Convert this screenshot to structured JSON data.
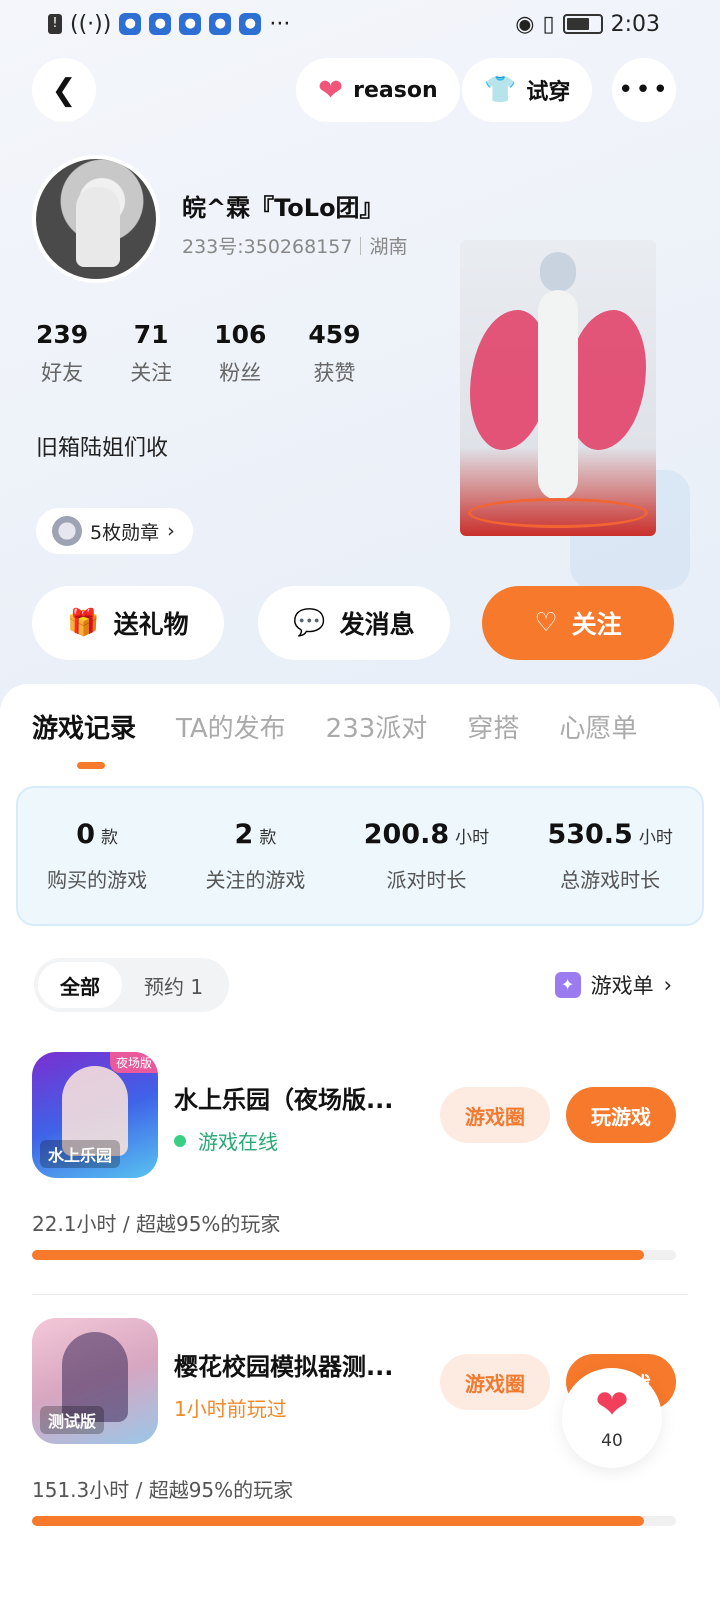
{
  "status_bar": {
    "time": "2:03"
  },
  "top_actions": {
    "reason_label": "reason",
    "tryon_label": "试穿"
  },
  "profile": {
    "nickname": "皖^霖『ToLo团』",
    "uid": "233号:350268157",
    "location": "湖南",
    "stats": [
      {
        "value": "239",
        "label": "好友"
      },
      {
        "value": "71",
        "label": "关注"
      },
      {
        "value": "106",
        "label": "粉丝"
      },
      {
        "value": "459",
        "label": "获赞"
      }
    ],
    "bio": "旧箱陆姐们收",
    "badges_label": "5枚勋章"
  },
  "actions": {
    "gift": "送礼物",
    "message": "发消息",
    "follow": "关注"
  },
  "tabs": [
    "游戏记录",
    "TA的发布",
    "233派对",
    "穿搭",
    "心愿单"
  ],
  "summary": [
    {
      "value": "0",
      "unit": "款",
      "label": "购买的游戏"
    },
    {
      "value": "2",
      "unit": "款",
      "label": "关注的游戏"
    },
    {
      "value": "200.8",
      "unit": "小时",
      "label": "派对时长"
    },
    {
      "value": "530.5",
      "unit": "小时",
      "label": "总游戏时长"
    }
  ],
  "filter": {
    "all": "全部",
    "reserve": "预约 1"
  },
  "game_list_link": "游戏单",
  "games": [
    {
      "title": "水上乐园（夜场版...",
      "status": "游戏在线",
      "icon_tag": "水上乐园",
      "icon_corner": "夜场版",
      "circle_label": "游戏圈",
      "play_label": "玩游戏",
      "meta": "22.1小时 / 超越95%的玩家",
      "progress": 0.95
    },
    {
      "title": "樱花校园模拟器测...",
      "status": "1小时前玩过",
      "icon_tag": "测试版",
      "circle_label": "游戏圈",
      "play_label": "玩游戏",
      "meta": "151.3小时 / 超越95%的玩家",
      "progress": 0.95
    }
  ],
  "like_float": {
    "count": "40"
  },
  "colors": {
    "accent": "#f7792b",
    "online": "#2aa876",
    "recent": "#f08a2b"
  }
}
